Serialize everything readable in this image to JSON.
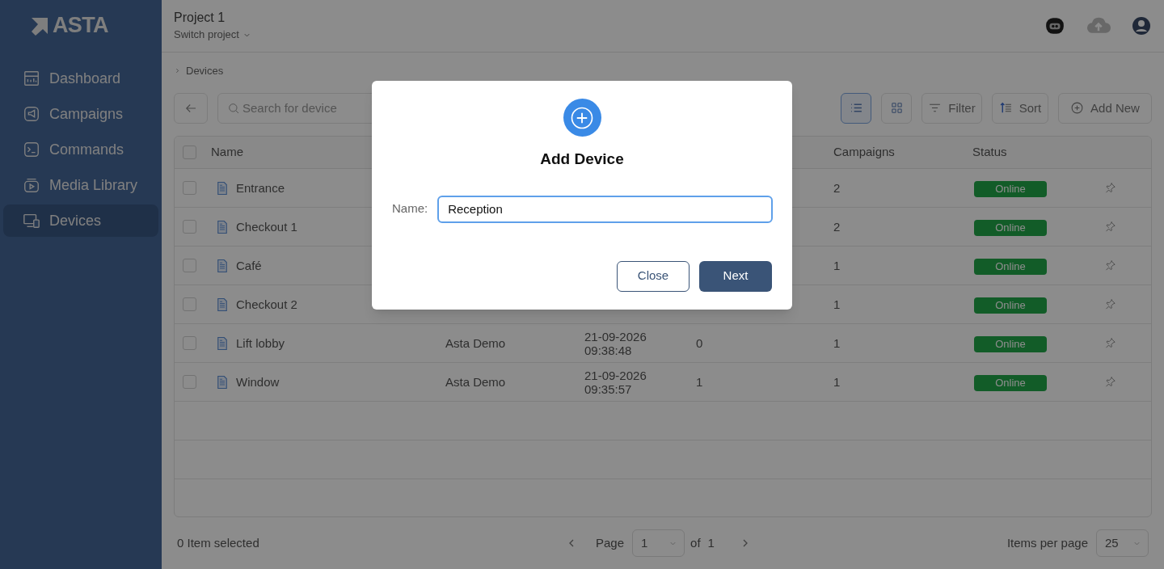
{
  "sidebar": {
    "logo": "ASTA",
    "items": [
      {
        "label": "Dashboard",
        "selected": false
      },
      {
        "label": "Campaigns",
        "selected": false
      },
      {
        "label": "Commands",
        "selected": false
      },
      {
        "label": "Media Library",
        "selected": false
      },
      {
        "label": "Devices",
        "selected": true
      }
    ]
  },
  "header": {
    "project": "Project 1",
    "switch": "Switch project"
  },
  "breadcrumb": [
    "Devices"
  ],
  "toolbar": {
    "search_placeholder": "Search for device",
    "view_modes": [
      {
        "kind": "list",
        "selected": true
      },
      {
        "kind": "grid",
        "selected": false
      }
    ],
    "filter": "Filter",
    "sort": "Sort",
    "add": "Add New"
  },
  "table": {
    "select_all_checked": false,
    "columns": {
      "name": "Name",
      "campaigns": "Campaigns",
      "status": "Status"
    },
    "rows": [
      {
        "checked": false,
        "name": "Entrance",
        "campaigns": "2",
        "status": "Online"
      },
      {
        "checked": false,
        "name": "Checkout 1",
        "campaigns": "2",
        "status": "Online"
      },
      {
        "checked": false,
        "name": "Café",
        "campaigns": "1",
        "status": "Online"
      },
      {
        "checked": false,
        "name": "Checkout 2",
        "campaigns": "1",
        "status": "Online"
      },
      {
        "checked": false,
        "name": "Lift lobby",
        "column_3": "Asta Demo",
        "column_4": [
          "21-09-2026",
          "09:38:48"
        ],
        "column_5": "0",
        "campaigns": "1",
        "status": "Online"
      },
      {
        "checked": false,
        "name": "Window",
        "column_3": "Asta Demo",
        "column_4": [
          "21-09-2026",
          "09:35:57"
        ],
        "column_5": "1",
        "campaigns": "1",
        "status": "Online"
      }
    ]
  },
  "footer": {
    "selected": "0 Item selected",
    "page_label": "Page",
    "page": "1",
    "of": "of",
    "pages": "1",
    "per_page_label": "Items per page",
    "per_page": "25"
  },
  "dialog": {
    "title": "Add Device",
    "field_label": "Name:",
    "field_value": "Reception",
    "buttons": [
      {
        "kind": "secondary",
        "label": "Close"
      },
      {
        "kind": "primary",
        "label": "Next"
      }
    ]
  }
}
